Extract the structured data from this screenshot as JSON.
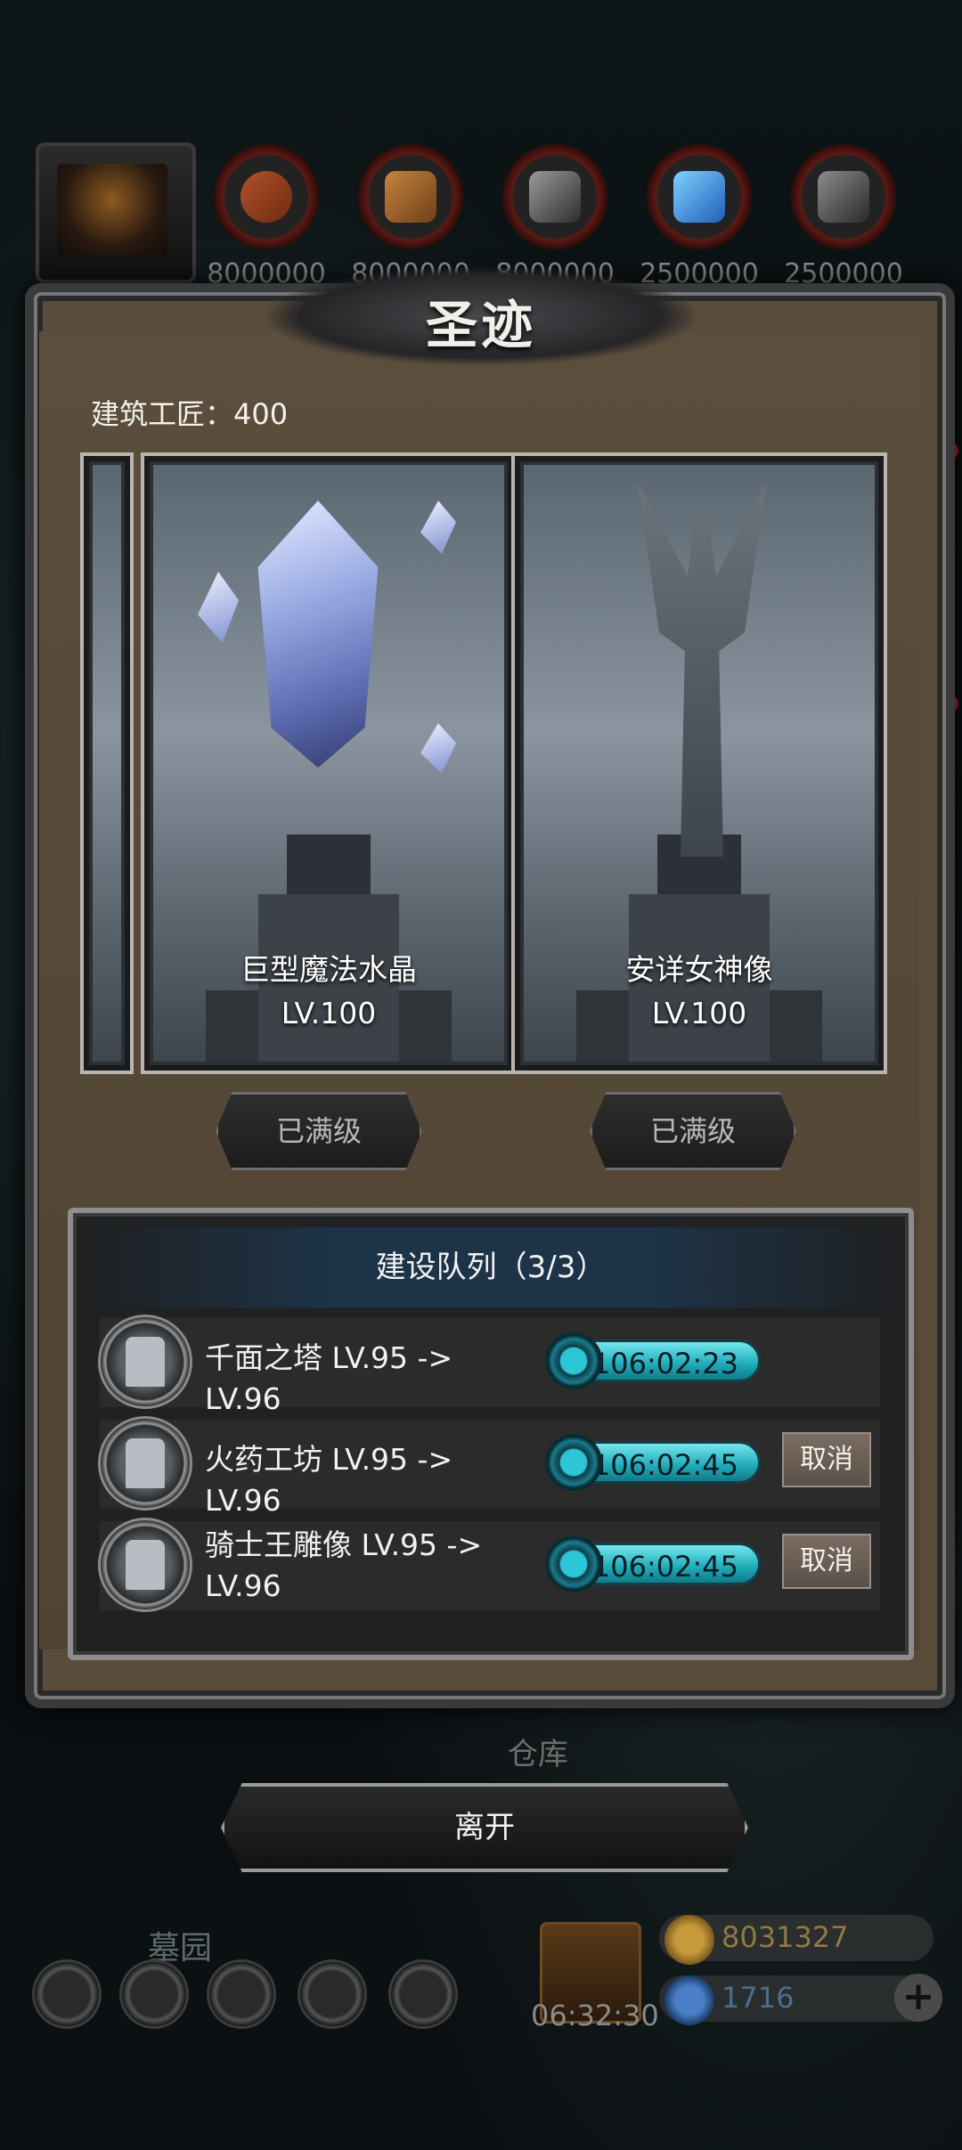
{
  "window_title": "圣迹",
  "craftsman": {
    "label": "建筑工匠：400"
  },
  "resources": [
    {
      "icon": "meat-resource-icon",
      "amount": "8000000"
    },
    {
      "icon": "wood-resource-icon",
      "amount": "8000000"
    },
    {
      "icon": "iron-resource-icon",
      "amount": "8000000"
    },
    {
      "icon": "crystal-resource-icon",
      "amount": "2500000"
    },
    {
      "icon": "stone-resource-icon",
      "amount": "2500000"
    }
  ],
  "cards": [
    {
      "name": "巨型魔法水晶",
      "level": "LV.100",
      "button": "已满级"
    },
    {
      "name": "安详女神像",
      "level": "LV.100",
      "button": "已满级"
    }
  ],
  "queue": {
    "title": "建设队列（3/3）",
    "items": [
      {
        "text": "千面之塔 LV.95 -> LV.96",
        "timer": "106:02:23"
      },
      {
        "text": "火药工坊 LV.95 -> LV.96",
        "timer": "106:02:45",
        "cancel": "取消"
      },
      {
        "text": "骑士王雕像 LV.95 -> LV.96",
        "timer": "106:02:45",
        "cancel": "取消"
      }
    ]
  },
  "leave_label": "离开",
  "background_labels": {
    "warehouse": "仓库",
    "graveyard": "墓园"
  },
  "hud": {
    "gift_timer": "06:32:30",
    "gold": "8031327",
    "gems": "1716",
    "plus": "+"
  },
  "colors": {
    "timer": "#2ec4d2",
    "frame": "#5a4c3b",
    "accent_red": "#c22222"
  }
}
